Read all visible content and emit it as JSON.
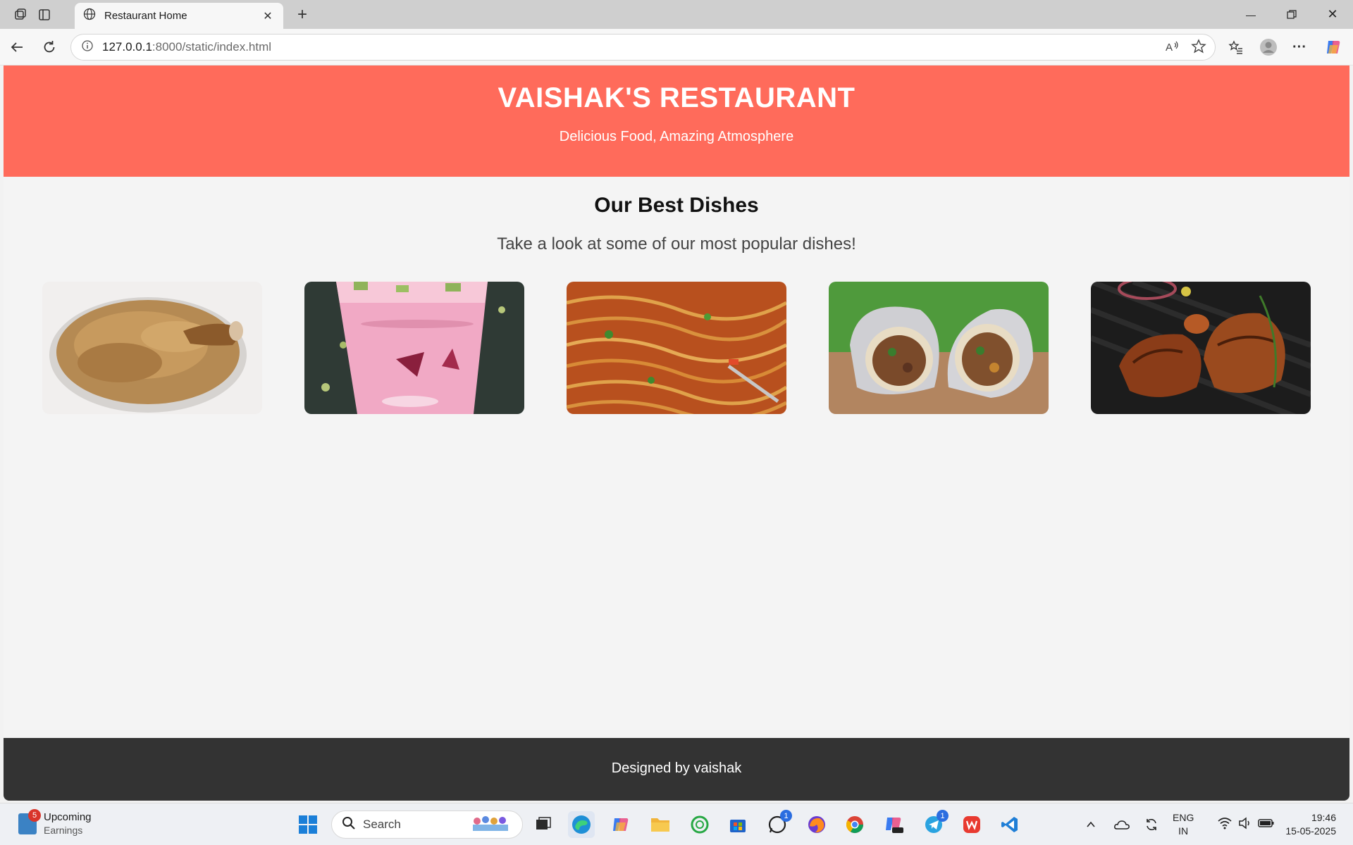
{
  "browser": {
    "tab_title": "Restaurant Home",
    "url_host": "127.0.0.1",
    "url_path": ":8000/static/index.html"
  },
  "page": {
    "header": {
      "title": "VAISHAK'S RESTAURANT",
      "tagline": "Delicious Food, Amazing Atmosphere"
    },
    "section": {
      "title": "Our Best Dishes",
      "subtitle": "Take a look at some of our most popular dishes!"
    },
    "dishes": [
      {
        "icon": "biryani-image"
      },
      {
        "icon": "falooda-image"
      },
      {
        "icon": "noodles-image"
      },
      {
        "icon": "burrito-image"
      },
      {
        "icon": "grilled-chicken-image"
      }
    ],
    "footer": {
      "text": "Designed by vaishak"
    },
    "colors": {
      "header_bg": "#ff6b5b",
      "footer_bg": "#333333",
      "page_bg": "#f4f4f4"
    }
  },
  "taskbar": {
    "widget": {
      "badge": "5",
      "title": "Upcoming",
      "subtitle": "Earnings"
    },
    "search_placeholder": "Search",
    "whatsapp_badge": "1",
    "telegram_badge": "1",
    "language": {
      "line1": "ENG",
      "line2": "IN"
    },
    "clock": {
      "time": "19:46",
      "date": "15-05-2025"
    }
  }
}
